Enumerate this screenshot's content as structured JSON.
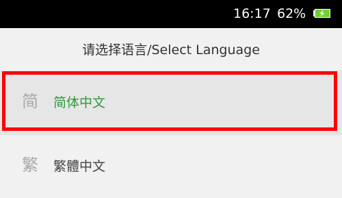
{
  "status_bar": {
    "time": "16:17",
    "battery_percent": "62%",
    "battery_icon": "charging-battery-icon",
    "battery_level": 0.62,
    "accent_color": "#2e9a3c"
  },
  "header": {
    "title": "请选择语言/Select Language"
  },
  "languages": [
    {
      "glyph": "简",
      "label": "简体中文",
      "selected": true
    },
    {
      "glyph": "繁",
      "label": "繁體中文",
      "selected": false
    }
  ],
  "highlight_color": "#ff0000"
}
